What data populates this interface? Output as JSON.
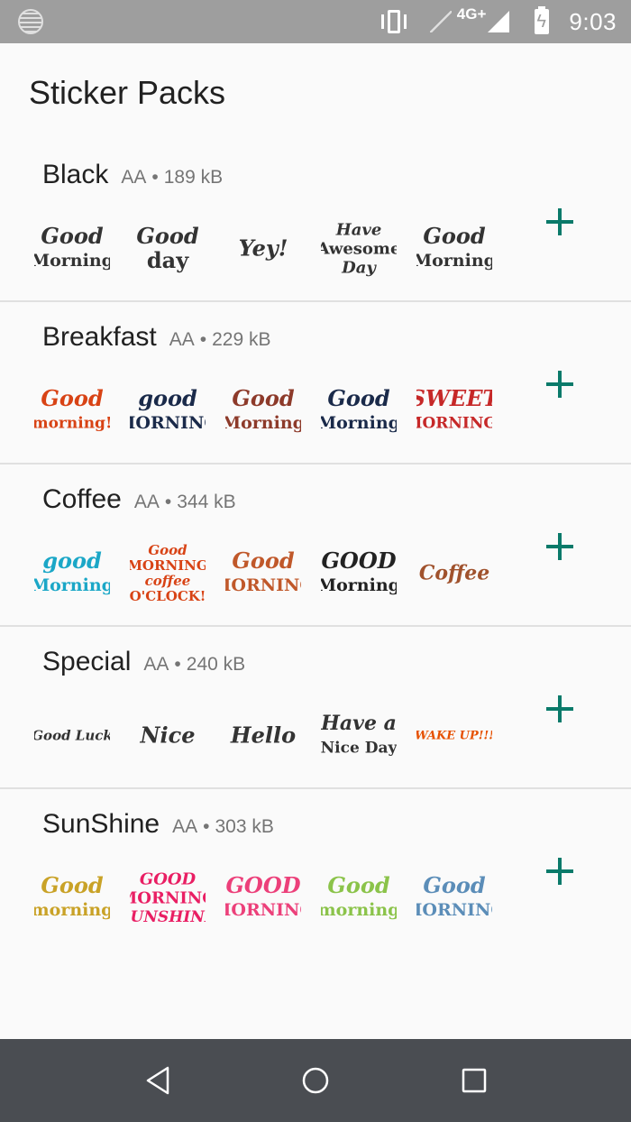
{
  "status_bar": {
    "network": "4G+",
    "time": "9:03",
    "icons": [
      "notification-icon",
      "vibrate-icon",
      "signal-empty-icon",
      "signal-full-icon",
      "battery-charging-icon"
    ]
  },
  "header": {
    "title": "Sticker Packs"
  },
  "packs": [
    {
      "name": "Black",
      "author": "AA",
      "separator": "•",
      "size": "189 kB",
      "stickers": [
        {
          "text": [
            "Good",
            "Morning"
          ],
          "color": "#333333"
        },
        {
          "text": [
            "Good",
            "day"
          ],
          "color": "#333333"
        },
        {
          "text": [
            "Yey!"
          ],
          "color": "#333333"
        },
        {
          "text": [
            "Have",
            "Awesome",
            "Day"
          ],
          "color": "#333333"
        },
        {
          "text": [
            "Good",
            "Morning"
          ],
          "color": "#333333"
        }
      ]
    },
    {
      "name": "Breakfast",
      "author": "AA",
      "separator": "•",
      "size": "229 kB",
      "stickers": [
        {
          "text": [
            "Good",
            "morning!"
          ],
          "color": "#d84315"
        },
        {
          "text": [
            "good",
            "MORNING"
          ],
          "color": "#1a2a4a"
        },
        {
          "text": [
            "Good",
            "Morning"
          ],
          "color": "#8d3a2a"
        },
        {
          "text": [
            "Good",
            "Morning"
          ],
          "color": "#1a2a4a"
        },
        {
          "text": [
            "SWEET",
            "MORNING!"
          ],
          "color": "#c62828"
        }
      ]
    },
    {
      "name": "Coffee",
      "author": "AA",
      "separator": "•",
      "size": "344 kB",
      "stickers": [
        {
          "text": [
            "good",
            "Morning"
          ],
          "color": "#1ba7c7"
        },
        {
          "text": [
            "Good",
            "MORNING",
            "coffee",
            "O'CLOCK!"
          ],
          "color": "#d84315"
        },
        {
          "text": [
            "Good",
            "MORNING"
          ],
          "color": "#c0582a"
        },
        {
          "text": [
            "GOOD",
            "Morning"
          ],
          "color": "#222222"
        },
        {
          "text": [
            "Coffee"
          ],
          "color": "#a0522d"
        }
      ]
    },
    {
      "name": "Special",
      "author": "AA",
      "separator": "•",
      "size": "240 kB",
      "stickers": [
        {
          "text": [
            "Good Luck"
          ],
          "color": "#333333"
        },
        {
          "text": [
            "Nice"
          ],
          "color": "#333333"
        },
        {
          "text": [
            "Hello"
          ],
          "color": "#333333"
        },
        {
          "text": [
            "Have a",
            "Nice Day"
          ],
          "color": "#333333"
        },
        {
          "text": [
            "WAKE UP!!!"
          ],
          "color": "#e65100"
        }
      ]
    },
    {
      "name": "SunShine",
      "author": "AA",
      "separator": "•",
      "size": "303 kB",
      "stickers": [
        {
          "text": [
            "Good",
            "morning"
          ],
          "color": "#c9a227"
        },
        {
          "text": [
            "GOOD",
            "MORNING",
            "SUNSHINE"
          ],
          "color": "#e91e63"
        },
        {
          "text": [
            "GOOD",
            "MORNING"
          ],
          "color": "#ec407a"
        },
        {
          "text": [
            "Good",
            "morning"
          ],
          "color": "#8bc34a"
        },
        {
          "text": [
            "Good",
            "MORNING"
          ],
          "color": "#5b8db8"
        }
      ]
    }
  ],
  "colors": {
    "accent": "#0a7a6a",
    "status_bar": "#9e9e9e",
    "nav_bar": "#4a4d52",
    "divider": "#e0e0e0"
  },
  "nav": {
    "icons": [
      "back-icon",
      "home-icon",
      "recents-icon"
    ]
  }
}
